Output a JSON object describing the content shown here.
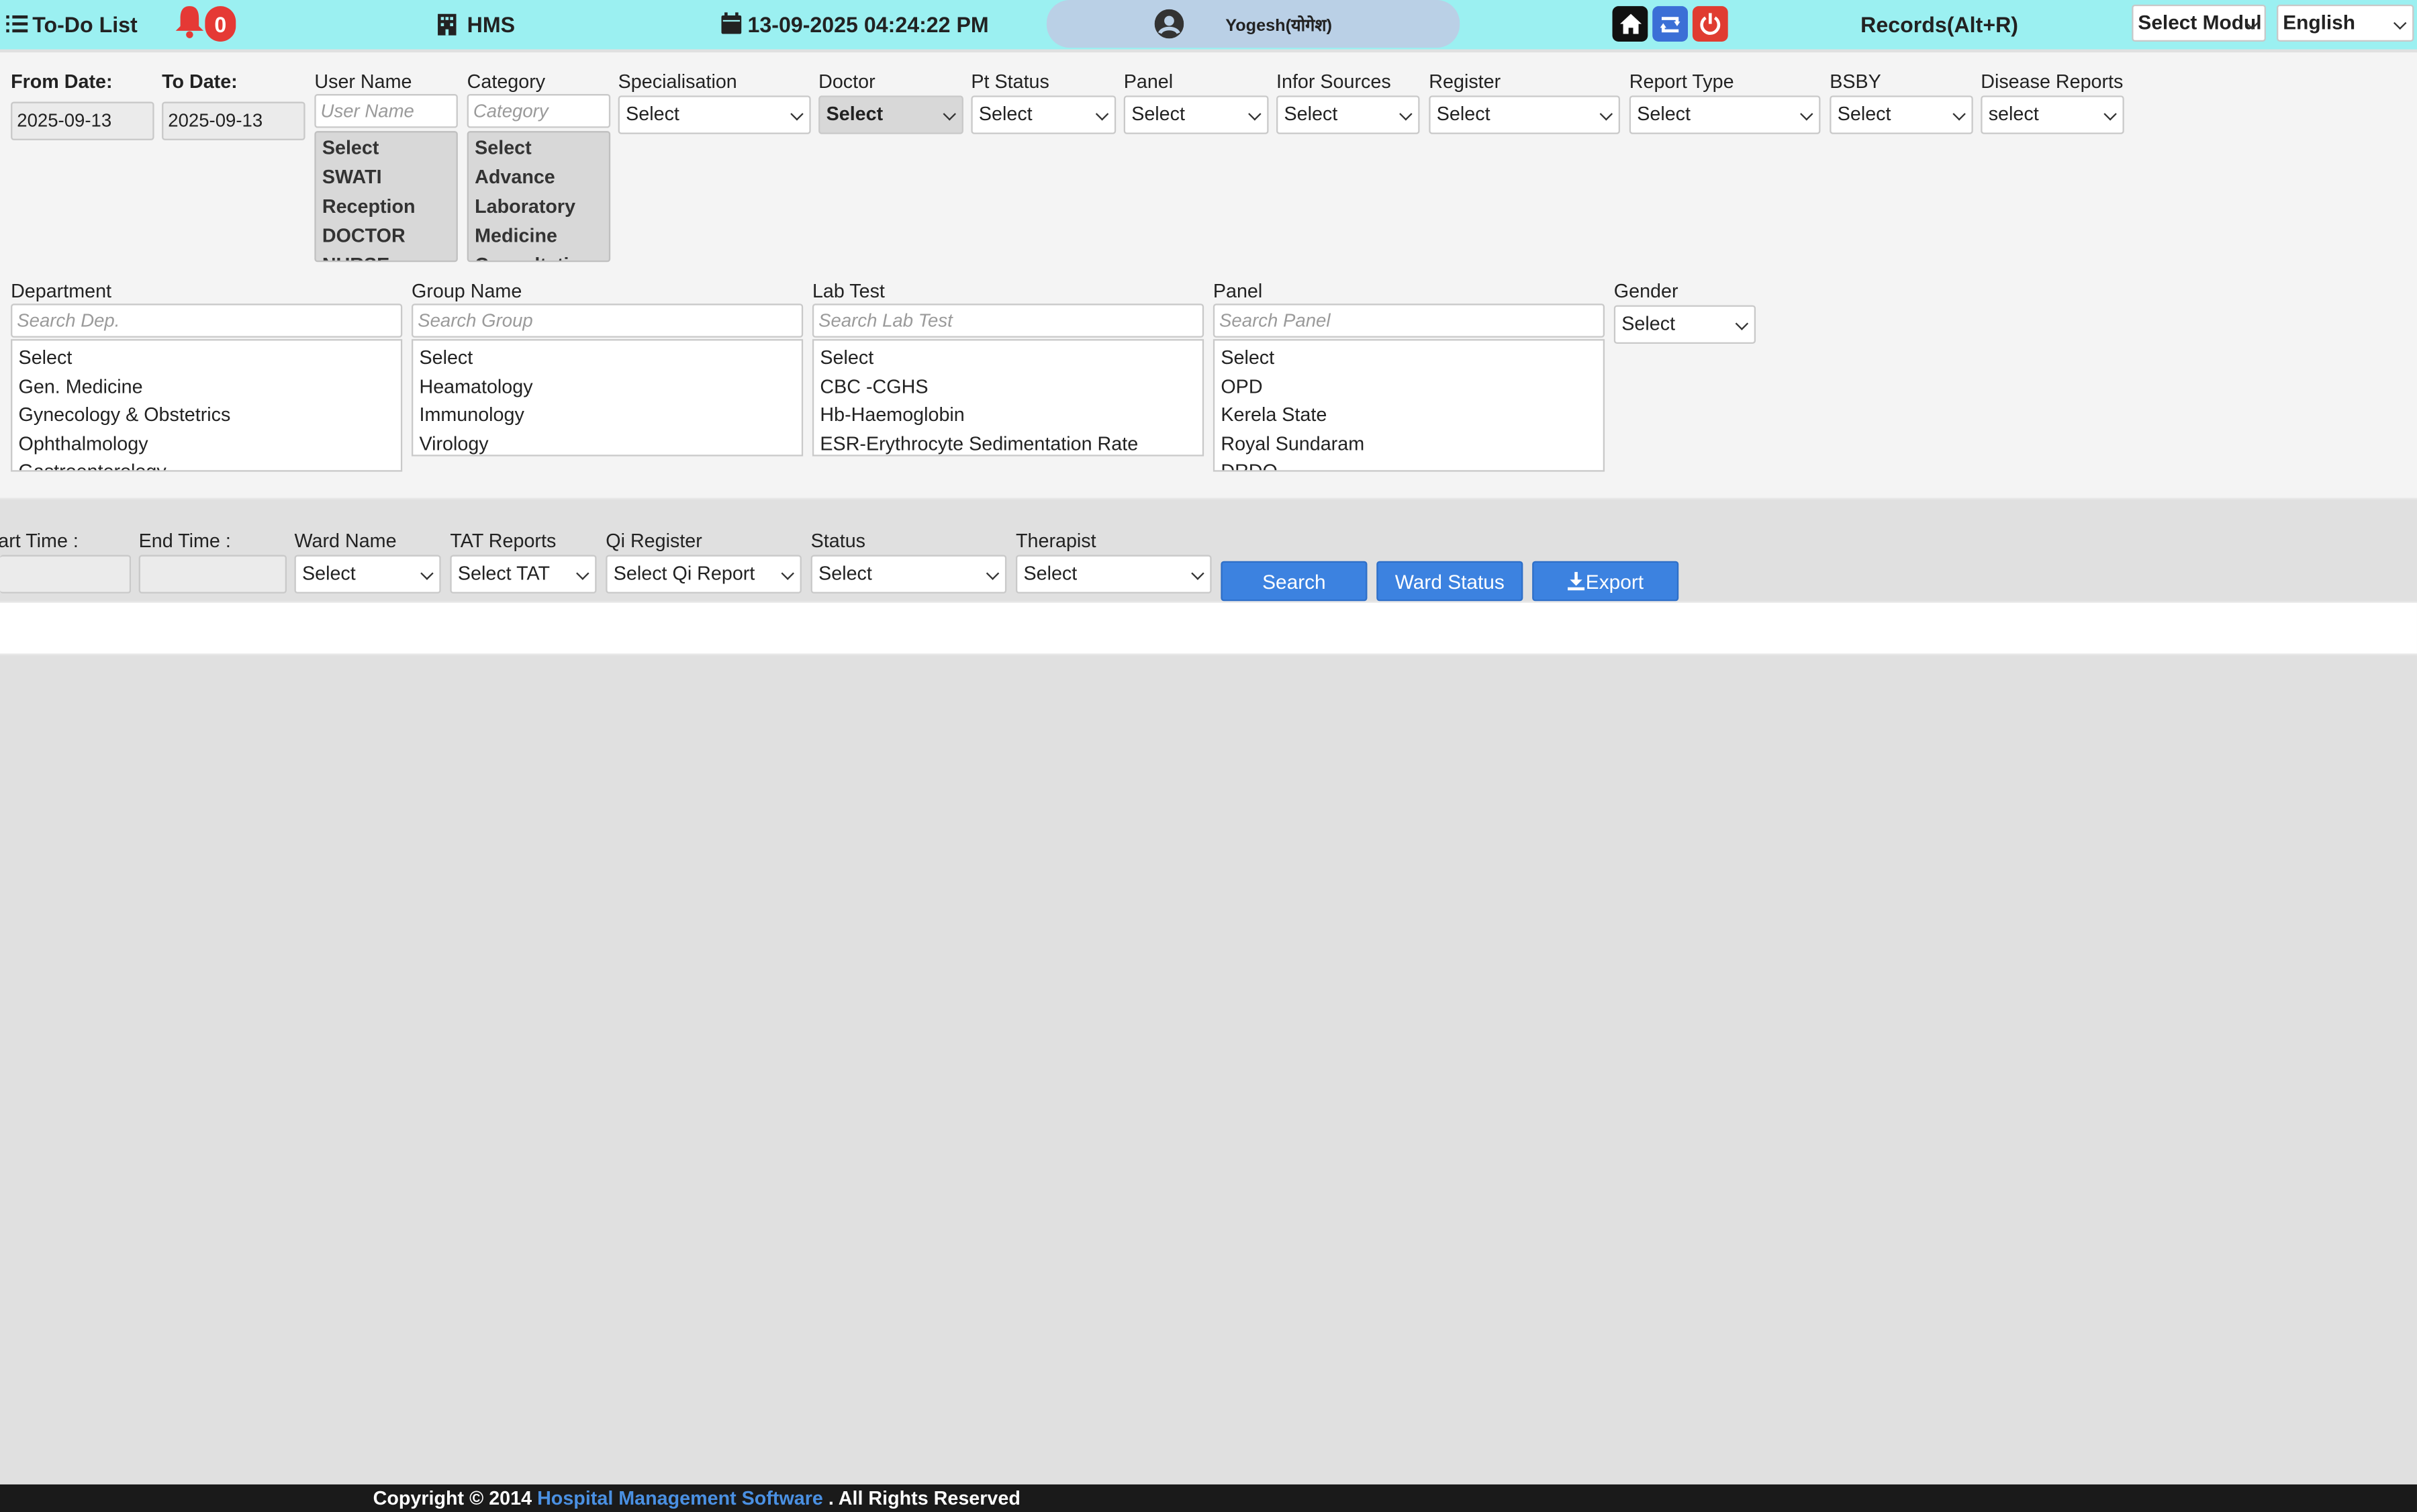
{
  "topbar": {
    "todo_label": "To-Do List",
    "notif_count": "0",
    "hms_label": "HMS",
    "datetime": "13-09-2025 04:24:22 PM",
    "user_name": "Yogesh(योगेश)",
    "records_label": "Records(Alt+R)",
    "module_select": "Select Modul",
    "language_select": "English"
  },
  "filters": {
    "from_date_label": "From Date:",
    "from_date_value": "2025-09-13",
    "to_date_label": "To Date:",
    "to_date_value": "2025-09-13",
    "user_name_label": "User Name",
    "user_name_placeholder": "User Name",
    "user_options": [
      "Select",
      "SWATI",
      "Reception",
      "DOCTOR",
      "NURSE"
    ],
    "category_label": "Category",
    "category_placeholder": "Category",
    "category_options": [
      "Select",
      "Advance",
      "Laboratory",
      "Medicine",
      "Consultation"
    ],
    "specialisation_label": "Specialisation",
    "specialisation_value": "Select",
    "doctor_label": "Doctor",
    "doctor_value": "Select",
    "pt_status_label": "Pt Status",
    "pt_status_value": "Select",
    "panel_label": "Panel",
    "panel_value": "Select",
    "infor_sources_label": "Infor Sources",
    "infor_sources_value": "Select",
    "register_label": "Register",
    "register_value": "Select",
    "report_type_label": "Report Type",
    "report_type_value": "Select",
    "bsby_label": "BSBY",
    "bsby_value": "Select",
    "disease_reports_label": "Disease Reports",
    "disease_reports_value": "select",
    "department_label": "Department",
    "department_placeholder": "Search Dep.",
    "department_options": [
      "Select",
      "Gen. Medicine",
      "Gynecology & Obstetrics",
      "Ophthalmology",
      "Gastroenterology"
    ],
    "group_label": "Group Name",
    "group_placeholder": "Search Group",
    "group_options": [
      "Select",
      "Heamatology",
      "Immunology",
      "Virology"
    ],
    "labtest_label": "Lab Test",
    "labtest_placeholder": "Search Lab Test",
    "labtest_options": [
      "Select",
      "CBC -CGHS",
      "Hb-Haemoglobin",
      "ESR-Erythrocyte Sedimentation Rate"
    ],
    "panel2_label": "Panel",
    "panel2_placeholder": "Search Panel",
    "panel2_options": [
      "Select",
      "OPD",
      "Kerela State",
      "Royal Sundaram",
      "DRDO"
    ],
    "gender_label": "Gender",
    "gender_value": "Select"
  },
  "row2": {
    "start_time_label": "Start Time :",
    "end_time_label": "End Time :",
    "ward_name_label": "Ward Name",
    "ward_name_value": "Select",
    "tat_label": "TAT Reports",
    "tat_value": "Select TAT",
    "qi_label": "Qi Register",
    "qi_value": "Select Qi Report",
    "status_label": "Status",
    "status_value": "Select",
    "therapist_label": "Therapist",
    "therapist_value": "Select",
    "search_button": "Search",
    "ward_status_button": "Ward Status",
    "export_button": "Export"
  },
  "footer": {
    "prefix": "Copyright © 2014",
    "link": "Hospital Management Software",
    "suffix": ". All Rights Reserved"
  },
  "colors": {
    "topbar": "#9bf0f1",
    "primary_button": "#3c82e0",
    "bell": "#e53935",
    "power_button": "#e03c31",
    "footer_bg": "#1a1a1a",
    "footer_link": "#4a90e2"
  }
}
